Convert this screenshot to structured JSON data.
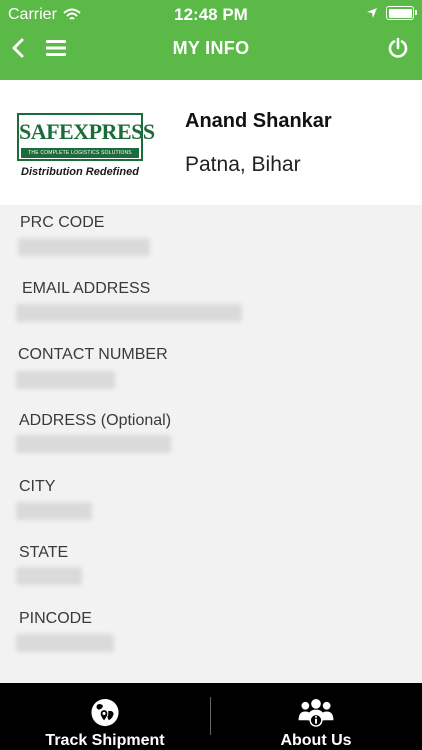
{
  "status_bar": {
    "carrier": "Carrier",
    "time": "12:48 PM"
  },
  "nav": {
    "title": "MY INFO",
    "back_icon": "chevron-left-icon",
    "menu_icon": "hamburger-menu-icon",
    "power_icon": "power-icon"
  },
  "profile": {
    "logo_word": "SAFEXPRESS",
    "logo_strip": "THE COMPLETE LOGISTICS SOLUTIONS",
    "logo_tagline": "Distribution Redefined",
    "name": "Anand Shankar",
    "location": "Patna, Bihar"
  },
  "fields": [
    {
      "label": "PRC CODE",
      "value": ""
    },
    {
      "label": "EMAIL ADDRESS",
      "value": ""
    },
    {
      "label": "CONTACT NUMBER",
      "value": ""
    },
    {
      "label": "ADDRESS (Optional)",
      "value": ""
    },
    {
      "label": "CITY",
      "value": ""
    },
    {
      "label": "STATE",
      "value": ""
    },
    {
      "label": "PINCODE",
      "value": ""
    }
  ],
  "tabs": [
    {
      "label": "Track Shipment",
      "icon": "globe-location-icon"
    },
    {
      "label": "About Us",
      "icon": "group-info-icon"
    }
  ],
  "colors": {
    "header_green": "#5bb947",
    "logo_green": "#1c6b3a",
    "tab_bar": "#000000"
  }
}
